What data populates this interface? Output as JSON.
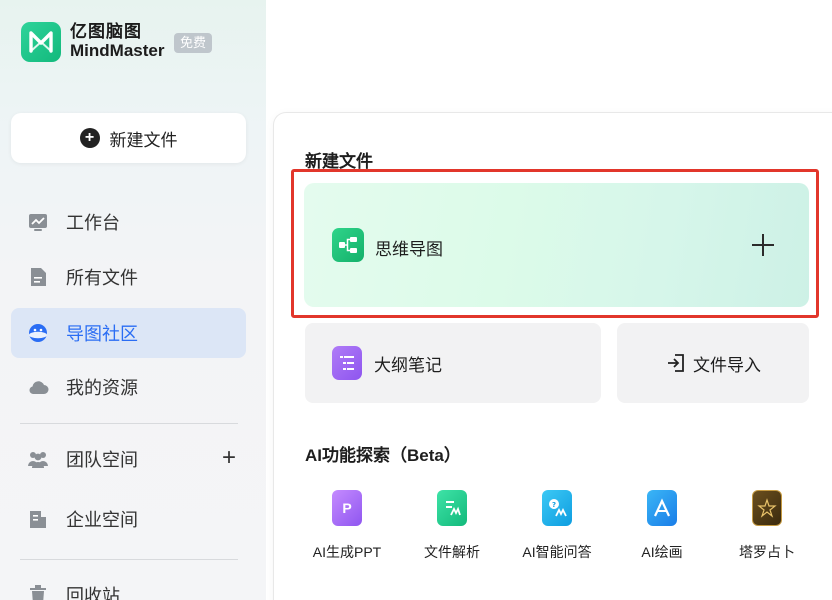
{
  "app": {
    "name_cn": "亿图脑图",
    "name_en": "MindMaster",
    "badge": "免费"
  },
  "sidebar": {
    "new_file_label": "新建文件",
    "items": [
      {
        "label": "工作台",
        "icon": "workbench-icon"
      },
      {
        "label": "所有文件",
        "icon": "file-icon"
      },
      {
        "label": "导图社区",
        "icon": "community-icon",
        "active": true
      },
      {
        "label": "我的资源",
        "icon": "cloud-icon"
      },
      {
        "label": "团队空间",
        "icon": "team-icon",
        "action": "+"
      },
      {
        "label": "企业空间",
        "icon": "enterprise-icon"
      },
      {
        "label": "回收站",
        "icon": "trash-icon"
      }
    ]
  },
  "main": {
    "new_file_title": "新建文件",
    "mindmap_label": "思维导图",
    "mindmap_plus": "+",
    "outline_label": "大纲笔记",
    "import_label": "文件导入",
    "ai_section_title": "AI功能探索（Beta）",
    "ai_tools": [
      {
        "label": "AI生成PPT",
        "icon": "ppt-icon"
      },
      {
        "label": "文件解析",
        "icon": "file-parse-icon"
      },
      {
        "label": "AI智能问答",
        "icon": "qa-icon"
      },
      {
        "label": "AI绘画",
        "icon": "paint-icon"
      },
      {
        "label": "塔罗占卜",
        "icon": "tarot-icon"
      }
    ]
  },
  "colors": {
    "accent": "#2a6df4",
    "active_bg": "#dce6f6",
    "highlight_border": "#e2362b",
    "brand_green": "#12b97c"
  }
}
